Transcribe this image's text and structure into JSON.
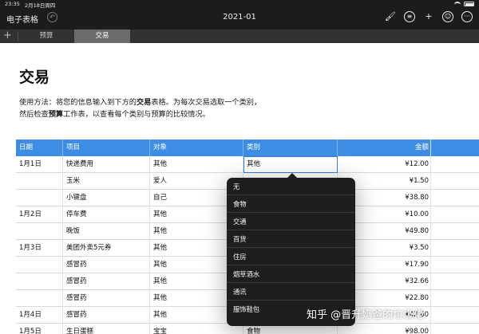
{
  "status": {
    "time": "23:35",
    "date": "2月18日周四"
  },
  "toolbar": {
    "back_label": "电子表格",
    "doc_title": "2021-01",
    "icons": [
      "undo-icon",
      "format-brush-icon",
      "comment-icon",
      "add-icon",
      "collaborate-icon",
      "more-icon"
    ]
  },
  "tabs": [
    {
      "label": "预算",
      "selected": false
    },
    {
      "label": "交易",
      "selected": true
    }
  ],
  "page": {
    "title": "交易",
    "intro_line1_a": "使用方法：将您的信息输入到下方的",
    "intro_line1_b": "交易",
    "intro_line1_c": "表格。为每次交易选取一个类别，",
    "intro_line2_a": "然后检查",
    "intro_line2_b": "预算",
    "intro_line2_c": "工作表，以查看每个类别与预算的比较情况。"
  },
  "table": {
    "columns": [
      "日期",
      "项目",
      "对象",
      "类别",
      "金额"
    ],
    "rows": [
      [
        "1月1日",
        "快递费用",
        "其他",
        "其他",
        "¥12.00"
      ],
      [
        "",
        "玉米",
        "爱人",
        "",
        "¥1.50"
      ],
      [
        "",
        "小键盘",
        "自己",
        "",
        "¥38.80"
      ],
      [
        "1月2日",
        "停车费",
        "其他",
        "",
        "¥10.00"
      ],
      [
        "",
        "晚饭",
        "其他",
        "",
        "¥49.80"
      ],
      [
        "1月3日",
        "美团外卖5元券",
        "其他",
        "",
        "¥3.50"
      ],
      [
        "",
        "感冒药",
        "其他",
        "",
        "¥17.90"
      ],
      [
        "",
        "感冒药",
        "其他",
        "",
        "¥32.66"
      ],
      [
        "",
        "感冒药",
        "其他",
        "",
        "¥22.80"
      ],
      [
        "1月4日",
        "感冒药",
        "其他",
        "",
        "¥42.60"
      ],
      [
        "1月5日",
        "生日蛋糕",
        "宝宝",
        "食物",
        "¥98.00"
      ]
    ]
  },
  "dropdown": {
    "options": [
      "无",
      "食物",
      "交通",
      "百货",
      "住房",
      "烟草酒水",
      "通讯",
      "服饰鞋包"
    ]
  },
  "watermark": {
    "text": "知乎 @晋升奶爸的垃圾佬"
  }
}
